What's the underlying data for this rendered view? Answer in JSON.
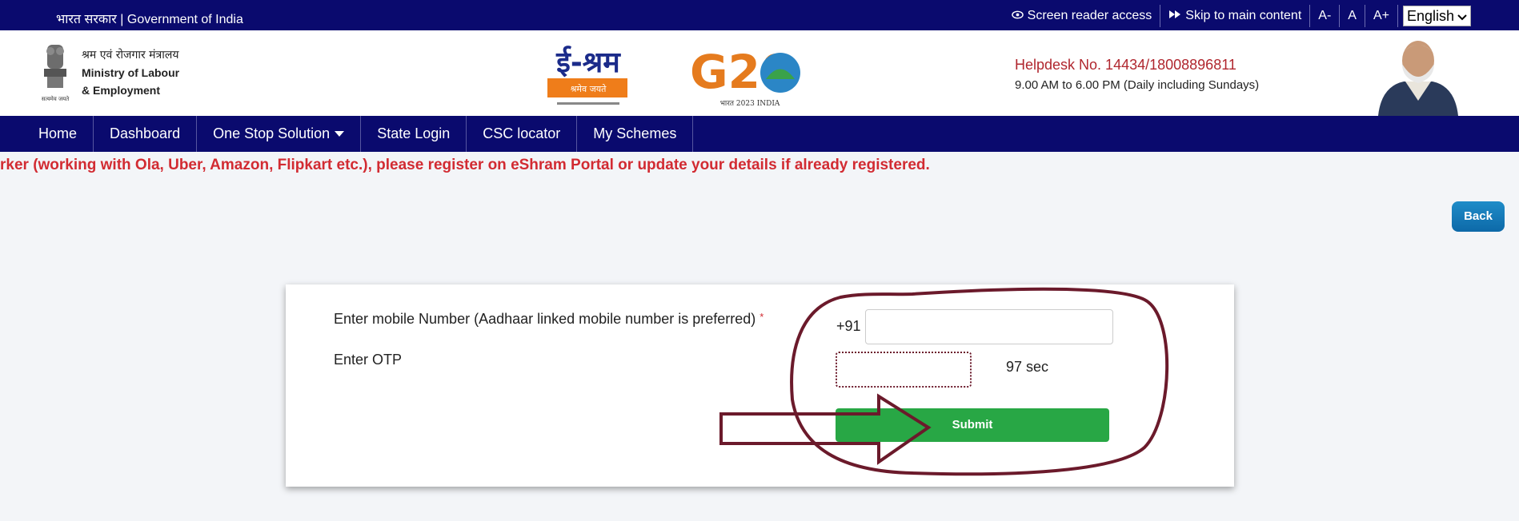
{
  "topbar": {
    "gov_label": "भारत सरकार | Government of India",
    "screen_reader": "Screen reader access",
    "skip": "Skip to main content",
    "font_minus": "A-",
    "font_normal": "A",
    "font_plus": "A+",
    "language": "English"
  },
  "header": {
    "ministry_hi": "श्रम एवं रोजगार मंत्रालय",
    "ministry_en_1": "Ministry of Labour",
    "ministry_en_2": "& Employment",
    "emblem_motto": "सत्यमेव जयते",
    "eshram_logo": "ई-श्रम",
    "eshram_tag": "श्रमेव जयते",
    "g20_logo": "G20",
    "g20_sub": "भारत 2023 INDIA",
    "helpdesk_no": "Helpdesk No. 14434/18008896811",
    "helpdesk_hours": "9.00 AM to 6.00 PM (Daily including Sundays)"
  },
  "nav": {
    "items": [
      "Home",
      "Dashboard",
      "One Stop Solution",
      "State Login",
      "CSC locator",
      "My Schemes"
    ]
  },
  "marquee": "rker (working with Ola, Uber, Amazon, Flipkart etc.), please register on eShram Portal or update your details if already registered.",
  "back_label": "Back",
  "form": {
    "mobile_label": "Enter mobile Number (Aadhaar linked mobile number is preferred)",
    "required_mark": "*",
    "country_code": "+91",
    "mobile_value": "",
    "otp_label": "Enter OTP",
    "otp_value": "",
    "timer": "97 sec",
    "submit_label": "Submit"
  },
  "colors": {
    "navy": "#0a0a6e",
    "alert_red": "#d22b32",
    "submit_green": "#28a745",
    "annotation_maroon": "#6b1a2b"
  }
}
